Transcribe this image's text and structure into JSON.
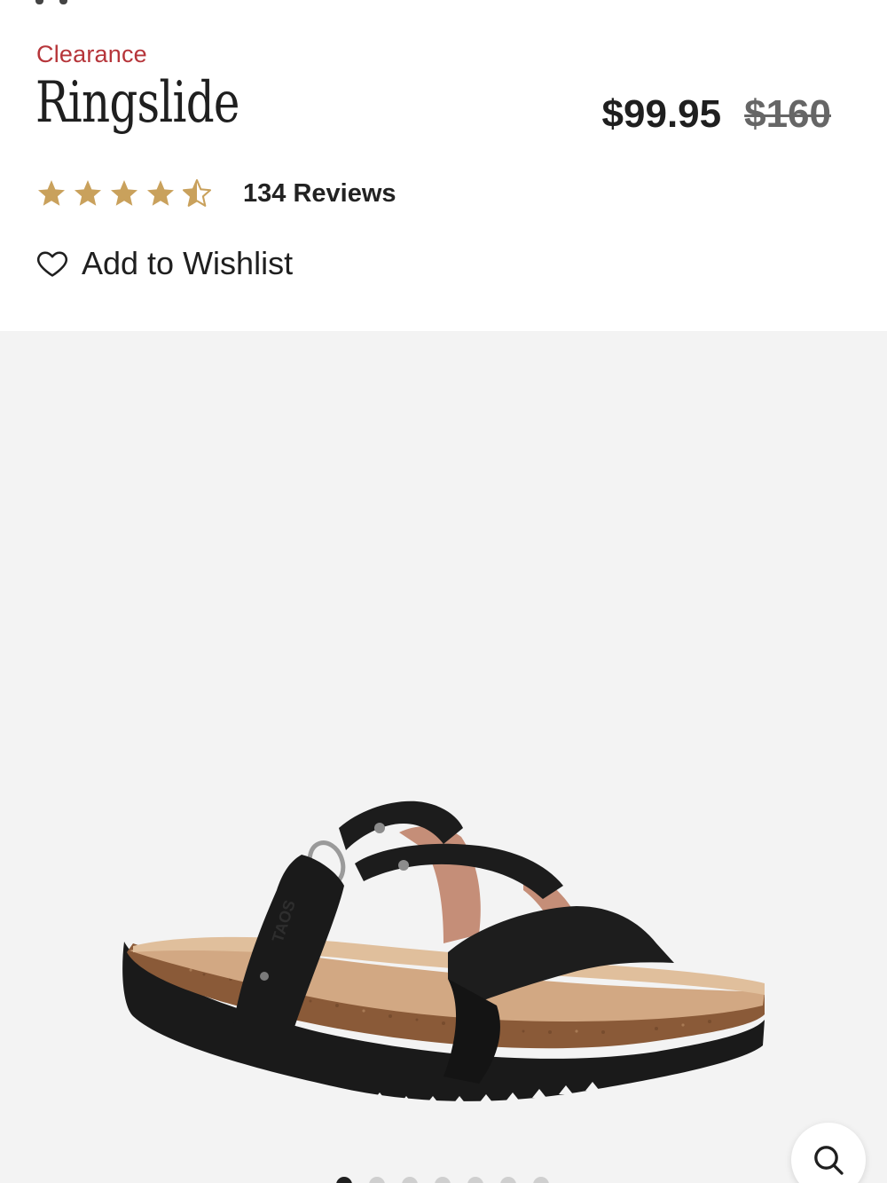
{
  "product": {
    "badge": "Clearance",
    "title": "Ringslide",
    "price_sale": "$99.95",
    "price_original": "$160",
    "rating": 4.5,
    "rating_max": 5,
    "reviews_label": "134 Reviews",
    "wishlist_label": "Add to Wishlist"
  },
  "gallery": {
    "image_count": 7,
    "active_index": 0,
    "zoom_icon": "search-icon"
  },
  "colors": {
    "badge": "#b6353a",
    "star": "#c9a15c",
    "gallery_bg": "#f3f3f3"
  }
}
